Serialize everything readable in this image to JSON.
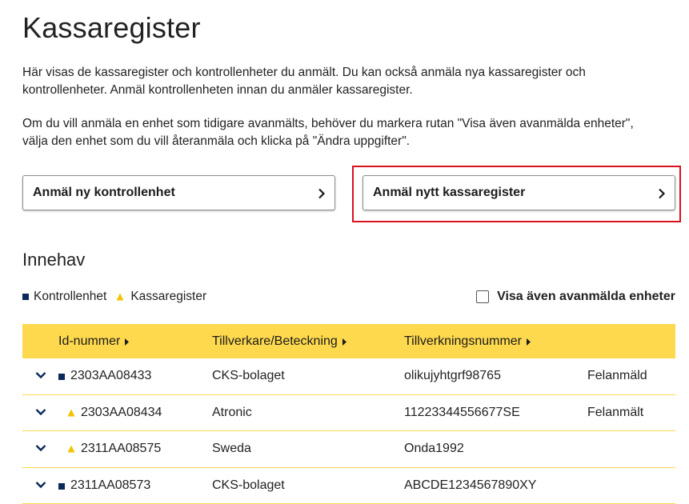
{
  "page": {
    "title": "Kassaregister",
    "intro_1": "Här visas de kassaregister och kontrollenheter du anmält. Du kan också anmäla nya kassaregister och kontrollenheter. Anmäl kontrollenheten innan du anmäler kassaregister.",
    "intro_2": "Om du vill anmäla en enhet som tidigare avanmälts, behöver du markera rutan \"Visa även avanmälda enheter\", välja den enhet som du vill återanmäla och klicka på \"Ändra uppgifter\"."
  },
  "actions": {
    "new_control_unit": "Anmäl ny kontrollenhet",
    "new_cash_register": "Anmäl nytt kassaregister"
  },
  "holdings": {
    "title": "Innehav",
    "legend": {
      "control_unit": "Kontrollenhet",
      "cash_register": "Kassaregister"
    },
    "show_removed_label": "Visa även avanmälda enheter",
    "show_removed_checked": false
  },
  "table": {
    "headers": {
      "id": "Id-nummer",
      "maker": "Tillverkare/Beteckning",
      "serial": "Tillverkningsnummer"
    },
    "rows": [
      {
        "type": "control_unit",
        "id": "2303AA08433",
        "maker": "CKS-bolaget",
        "serial": "olikujyhtgrf98765",
        "status": "Felanmäld"
      },
      {
        "type": "cash_register",
        "id": "2303AA08434",
        "maker": "Atronic",
        "serial": "11223344556677SE",
        "status": "Felanmält"
      },
      {
        "type": "cash_register",
        "id": "2311AA08575",
        "maker": "Sweda",
        "serial": "Onda1992",
        "status": ""
      },
      {
        "type": "control_unit",
        "id": "2311AA08573",
        "maker": "CKS-bolaget",
        "serial": "ABCDE1234567890XY",
        "status": ""
      }
    ]
  },
  "colors": {
    "header_yellow": "#fed94e",
    "navy": "#0b2a5b",
    "highlight_red": "#d9121f",
    "triangle_yellow": "#f2c400"
  },
  "icons": {
    "chevron": "chevron-right-icon",
    "expand": "chevron-down-icon",
    "control_unit": "square-icon",
    "cash_register": "triangle-icon",
    "sort": "caret-right-icon"
  }
}
